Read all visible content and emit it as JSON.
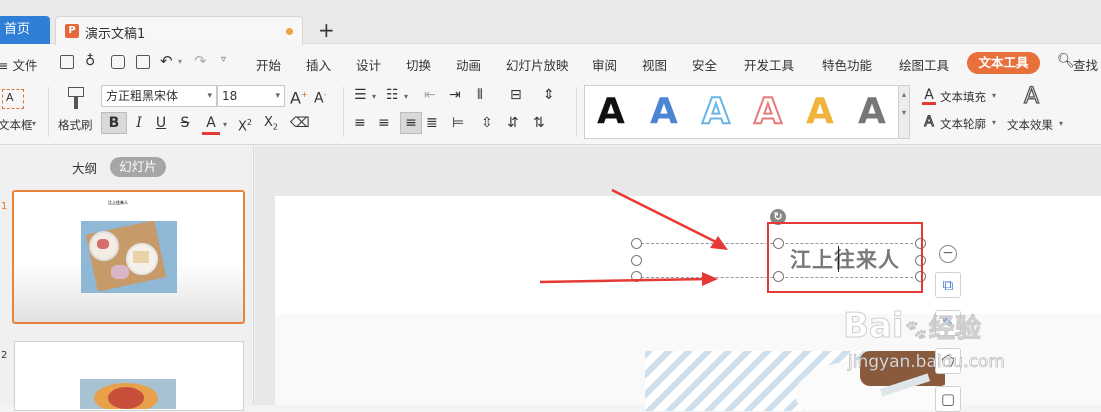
{
  "tabs": {
    "home": "首页",
    "doc": "演示文稿1",
    "new": "+"
  },
  "quick": {
    "file": "≡ 文件"
  },
  "menu": {
    "items": [
      "开始",
      "插入",
      "设计",
      "切换",
      "动画",
      "幻灯片放映",
      "审阅",
      "视图",
      "安全",
      "开发工具",
      "特色功能",
      "绘图工具"
    ],
    "active": "文本工具",
    "search": "查找"
  },
  "ribbon": {
    "textbox_label": "文本框",
    "format_painter": "格式刷",
    "font_name": "方正粗黑宋体",
    "font_size": "18",
    "text_fill": "文本填充",
    "text_outline": "文本轮廓",
    "text_effect": "文本效果",
    "gallery_letters": [
      "A",
      "A",
      "A",
      "A",
      "A",
      "A"
    ],
    "gallery_colors": [
      "#111111",
      "#4a86d4",
      "#6bb6e6",
      "#e77b7b",
      "#f0b43c",
      "#777777"
    ]
  },
  "panel": {
    "tab_outline": "大纲",
    "tab_slides": "幻灯片",
    "slide1_num": "1",
    "slide2_num": "2",
    "slide1_title": "江上往来人"
  },
  "slide": {
    "title_text": "江上往来人"
  },
  "watermark": {
    "brand": "Bai",
    "brand2": "经验",
    "url": "jingyan.baidu.com"
  }
}
